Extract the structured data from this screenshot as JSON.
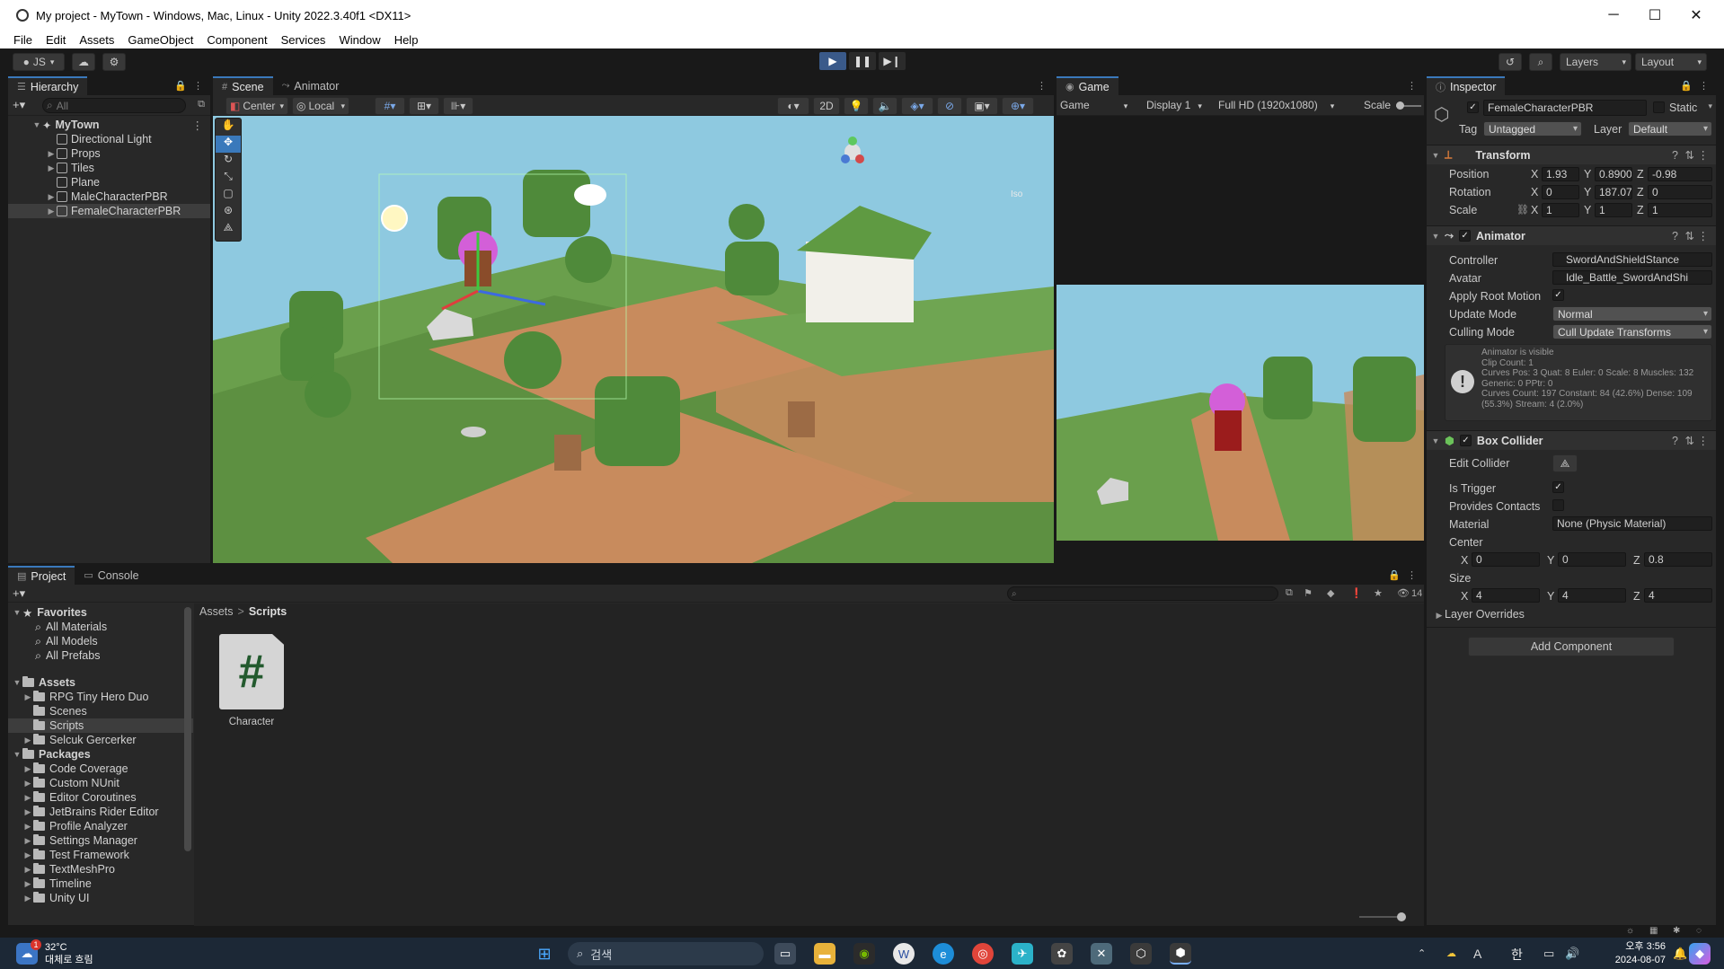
{
  "window": {
    "title": "My project - MyTown - Windows, Mac, Linux - Unity 2022.3.40f1 <DX11>",
    "controls": [
      "─",
      "☐",
      "✕"
    ]
  },
  "menu": [
    "File",
    "Edit",
    "Assets",
    "GameObject",
    "Component",
    "Services",
    "Window",
    "Help"
  ],
  "toolbar": {
    "account": "JS",
    "layers": "Layers",
    "layout": "Layout"
  },
  "hierarchy": {
    "tab": "Hierarchy",
    "search_placeholder": "All",
    "scene": "MyTown",
    "items": [
      {
        "label": "Directional Light",
        "expandable": false
      },
      {
        "label": "Props",
        "expandable": true
      },
      {
        "label": "Tiles",
        "expandable": true
      },
      {
        "label": "Plane",
        "expandable": false
      },
      {
        "label": "MaleCharacterPBR",
        "expandable": true
      },
      {
        "label": "FemaleCharacterPBR",
        "expandable": true
      }
    ]
  },
  "scene": {
    "tabs": [
      "Scene",
      "Animator"
    ],
    "pivot": "Center",
    "space": "Local",
    "mode2d": "2D",
    "persp": "Iso"
  },
  "game": {
    "tab": "Game",
    "mode": "Game",
    "display": "Display 1",
    "resolution": "Full HD (1920x1080)",
    "scale_label": "Scale"
  },
  "inspector": {
    "tab": "Inspector",
    "object_name": "FemaleCharacterPBR",
    "static_label": "Static",
    "tag_label": "Tag",
    "tag": "Untagged",
    "layer_label": "Layer",
    "layer": "Default",
    "transform": {
      "title": "Transform",
      "position_label": "Position",
      "rotation_label": "Rotation",
      "scale_label": "Scale",
      "position": {
        "x": "1.93",
        "y": "0.8900",
        "z": "-0.98"
      },
      "rotation": {
        "x": "0",
        "y": "187.07",
        "z": "0"
      },
      "scale": {
        "x": "1",
        "y": "1",
        "z": "1"
      }
    },
    "animator": {
      "title": "Animator",
      "controller_label": "Controller",
      "controller": "SwordAndShieldStance",
      "avatar_label": "Avatar",
      "avatar": "Idle_Battle_SwordAndShi",
      "apply_root_motion_label": "Apply Root Motion",
      "update_mode_label": "Update Mode",
      "update_mode": "Normal",
      "culling_mode_label": "Culling Mode",
      "culling_mode": "Cull Update Transforms",
      "info": [
        "Animator is visible",
        "Clip Count: 1",
        "Curves Pos: 3 Quat: 8 Euler: 0 Scale: 8 Muscles: 132",
        "Generic: 0 PPtr: 0",
        "Curves Count: 197 Constant: 84 (42.6%) Dense: 109",
        "(55.3%) Stream: 4 (2.0%)"
      ]
    },
    "box_collider": {
      "title": "Box Collider",
      "edit_collider_label": "Edit Collider",
      "is_trigger_label": "Is Trigger",
      "provides_contacts_label": "Provides Contacts",
      "material_label": "Material",
      "material": "None (Physic Material)",
      "center_label": "Center",
      "center": {
        "x": "0",
        "y": "0",
        "z": "0.8"
      },
      "size_label": "Size",
      "size": {
        "x": "4",
        "y": "4",
        "z": "4"
      }
    },
    "layer_overrides_label": "Layer Overrides",
    "add_component": "Add Component"
  },
  "project": {
    "tabs": [
      "Project",
      "Console"
    ],
    "favorites_label": "Favorites",
    "favorites": [
      "All Materials",
      "All Models",
      "All Prefabs"
    ],
    "assets_label": "Assets",
    "assets": [
      "RPG Tiny Hero Duo",
      "Scenes",
      "Scripts",
      "Selcuk Gercerker"
    ],
    "packages_label": "Packages",
    "packages": [
      "Code Coverage",
      "Custom NUnit",
      "Editor Coroutines",
      "JetBrains Rider Editor",
      "Profile Analyzer",
      "Settings Manager",
      "Test Framework",
      "TextMeshPro",
      "Timeline",
      "Unity UI"
    ],
    "breadcrumb": [
      "Assets",
      "Scripts"
    ],
    "breadcrumb_sep": ">",
    "file_name": "Character",
    "file_glyph": "#",
    "hidden_count": "14"
  },
  "taskbar": {
    "temperature": "32°C",
    "weather": "대체로 흐림",
    "search": "검색",
    "ime": "한",
    "time": "오후 3:56",
    "date": "2024-08-07",
    "notif_badge": "1"
  },
  "colors": {
    "accent": "#3a79bb",
    "panel": "#282828",
    "sky": "#8ec9e0",
    "grass": "#6a9f4c",
    "path": "#c88b5d"
  }
}
